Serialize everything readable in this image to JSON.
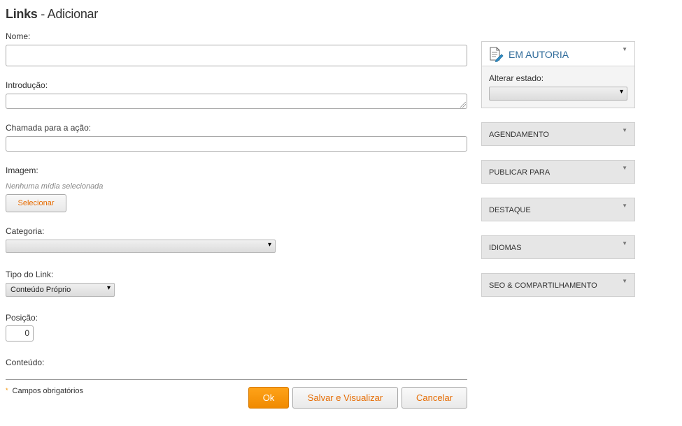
{
  "header": {
    "title_strong": "Links",
    "title_rest": " - Adicionar"
  },
  "form": {
    "name_label": "Nome:",
    "name_value": "",
    "intro_label": "Introdução:",
    "intro_value": "",
    "cta_label": "Chamada para a ação:",
    "cta_value": "",
    "image_label": "Imagem:",
    "image_empty": "Nenhuma mídia selecionada",
    "select_button": "Selecionar",
    "category_label": "Categoria:",
    "category_value": "",
    "link_type_label": "Tipo do Link:",
    "link_type_value": "Conteúdo Próprio",
    "position_label": "Posição:",
    "position_value": "0",
    "content_label": "Conteúdo:"
  },
  "footer": {
    "required_note": "Campos obrigatórios",
    "ok_button": "Ok",
    "save_preview_button": "Salvar e Visualizar",
    "cancel_button": "Cancelar"
  },
  "sidebar": {
    "status_title": "EM AUTORIA",
    "change_state_label": "Alterar estado:",
    "change_state_value": "",
    "panels": [
      {
        "label": "AGENDAMENTO"
      },
      {
        "label": "PUBLICAR PARA"
      },
      {
        "label": "DESTAQUE"
      },
      {
        "label": "IDIOMAS"
      },
      {
        "label": "SEO & COMPARTILHAMENTO"
      }
    ]
  },
  "icons": {
    "dropdown": "▾",
    "caret": "▼",
    "required": "*",
    "document": "document-edit-icon"
  },
  "colors": {
    "accent_orange": "#f39200",
    "link_orange": "#e66b00",
    "status_blue": "#2f6b9a"
  }
}
